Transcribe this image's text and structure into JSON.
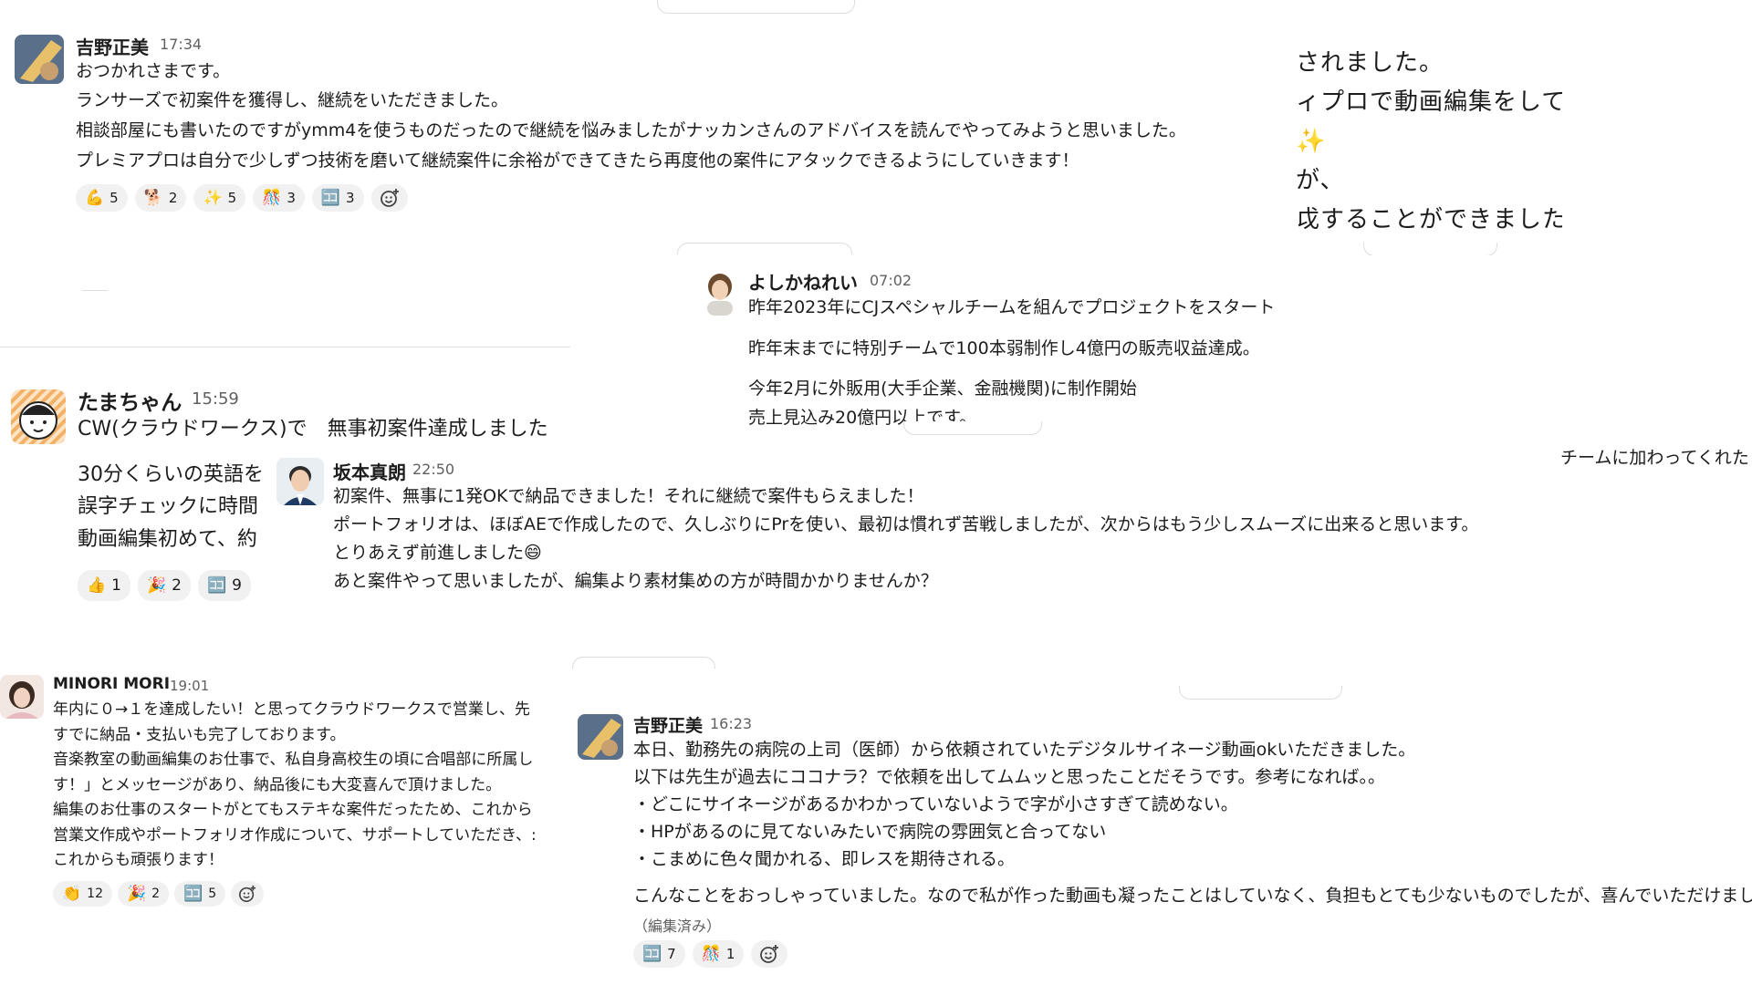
{
  "p1": {
    "name": "吉野正美",
    "time": "17:34",
    "lines": [
      "おつかれさまです。",
      "ランサーズで初案件を獲得し、継続をいただきました。",
      "相談部屋にも書いたのですがymm4を使うものだったので継続を悩みましたがナッカンさんのアドバイスを読んでやってみようと思いました。",
      "プレミアプロは自分で少しずつ技術を磨いて継続案件に余裕ができてきたら再度他の案件にアタックできるようにしていきます！"
    ],
    "reactions": [
      {
        "emoji": "💪",
        "count": "5"
      },
      {
        "emoji": "🐕",
        "count": "2"
      },
      {
        "emoji": "✨",
        "count": "5"
      },
      {
        "emoji": "🎊",
        "count": "3"
      },
      {
        "emoji": "🈁",
        "count": "3"
      }
    ]
  },
  "p2": {
    "lines": [
      "されました。",
      "ィプロで動画編集をして、",
      "✨",
      "が、",
      "戉することができました。"
    ]
  },
  "p3": {
    "name": "よしかねれい",
    "time": "07:02",
    "lines": [
      "昨年2023年にCJスペシャルチームを組んでプロジェクトをスタート",
      "昨年末までに特別チームで100本弱制作し4億円の販売収益達成。",
      "今年2月に外販用(大手企業、金融機関)に制作開始",
      "売上見込み20億円以上です。"
    ]
  },
  "p4": {
    "name": "たまちゃん",
    "time": "15:59",
    "lines": [
      "CW(クラウドワークス)で　無事初案件達成しました",
      "30分くらいの英語を",
      "誤字チェックに時間",
      "動画編集初めて、約"
    ],
    "reactions": [
      {
        "emoji": "👍",
        "count": "1"
      },
      {
        "emoji": "🎉",
        "count": "2"
      },
      {
        "emoji": "🈁",
        "count": "9"
      }
    ]
  },
  "p5": {
    "name": "坂本真朗",
    "time": "22:50",
    "lines": [
      "初案件、無事に1発OKで納品できました！それに継続で案件もらえました！",
      "ポートフォリオは、ほぼAEで作成したので、久しぶりにPrを使い、最初は慣れず苦戦しましたが、次からはもう少しスムーズに出来ると思います。",
      "とりあえず前進しました😄",
      "あと案件やって思いましたが、編集より素材集めの方が時間かかりませんか？"
    ]
  },
  "p6": {
    "text": "チームに加わってくれた"
  },
  "p7": {
    "name": "MINORI MORI",
    "time": "19:01",
    "lines": [
      "年内に０→１を達成したい！と思ってクラウドワークスで営業し、先",
      "すでに納品・支払いも完了しております。",
      "音楽教室の動画編集のお仕事で、私自身高校生の頃に合唱部に所属し",
      "す！」とメッセージがあり、納品後にも大変喜んで頂けました。",
      "編集のお仕事のスタートがとてもステキな案件だったため、これから",
      "営業文作成やポートフォリオ作成について、サポートしていただき、:",
      "これからも頑張ります！"
    ],
    "reactions": [
      {
        "emoji": "👏",
        "count": "12"
      },
      {
        "emoji": "🎉",
        "count": "2"
      },
      {
        "emoji": "🈁",
        "count": "5"
      }
    ]
  },
  "p8": {
    "name": "吉野正美",
    "time": "16:23",
    "lines": [
      "本日、勤務先の病院の上司（医師）から依頼されていたデジタルサイネージ動画okいただきました。",
      "以下は先生が過去にココナラ？で依頼を出してムムッと思ったことだそうです。参考になれば。。",
      "・どこにサイネージがあるかわかっていないようで字が小さすぎて読めない。",
      "・HPがあるのに見てないみたいで病院の雰囲気と合ってない",
      "・こまめに色々聞かれる、即レスを期待される。",
      "こんなことをおっしゃっていました。なので私が作った動画も凝ったことはしていなく、負担もとても少ないものでしたが、喜んでいただけまし"
    ],
    "edited": "（編集済み）",
    "reactions": [
      {
        "emoji": "🈁",
        "count": "7"
      },
      {
        "emoji": "🎊",
        "count": "1"
      }
    ]
  }
}
